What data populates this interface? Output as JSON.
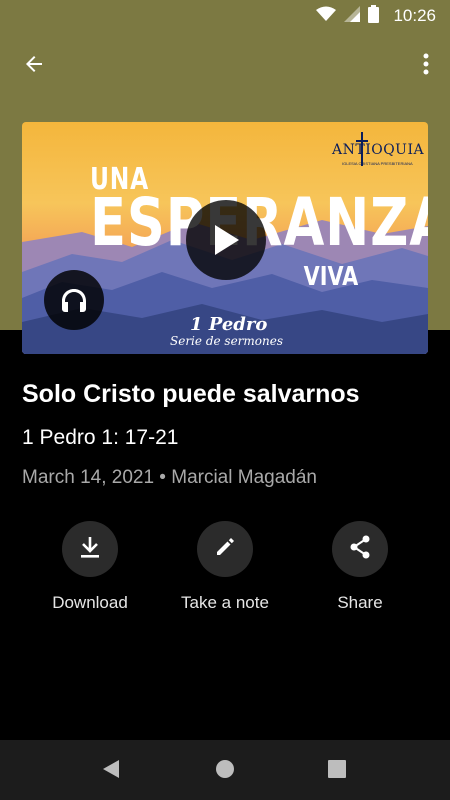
{
  "status_bar": {
    "time": "10:26",
    "icons": [
      "wifi-icon",
      "cell-signal-icon",
      "battery-icon"
    ]
  },
  "app_bar": {
    "back_icon": "arrow-left-icon",
    "more_icon": "more-vertical-icon"
  },
  "artwork": {
    "line1": "UNA",
    "line2": "ESPERANZA",
    "line3": "VIVA",
    "book": "1 Pedro",
    "series": "Serie de sermones",
    "logo_text": "ANTIOQUIA",
    "logo_sub": "IGLESIA CRISTIANA PRESBITERIANA"
  },
  "sermon": {
    "title": "Solo Cristo puede salvarnos",
    "passage": "1 Pedro 1: 17-21",
    "meta": "March 14, 2021 • Marcial Magadán"
  },
  "actions": [
    {
      "label": "Download",
      "icon": "download-icon"
    },
    {
      "label": "Take a note",
      "icon": "pencil-icon"
    },
    {
      "label": "Share",
      "icon": "share-icon"
    }
  ],
  "colors": {
    "top_band": "#7c7942",
    "background": "#000000",
    "action_circle": "#2b2b2b",
    "meta_text": "#a9a9a9"
  }
}
